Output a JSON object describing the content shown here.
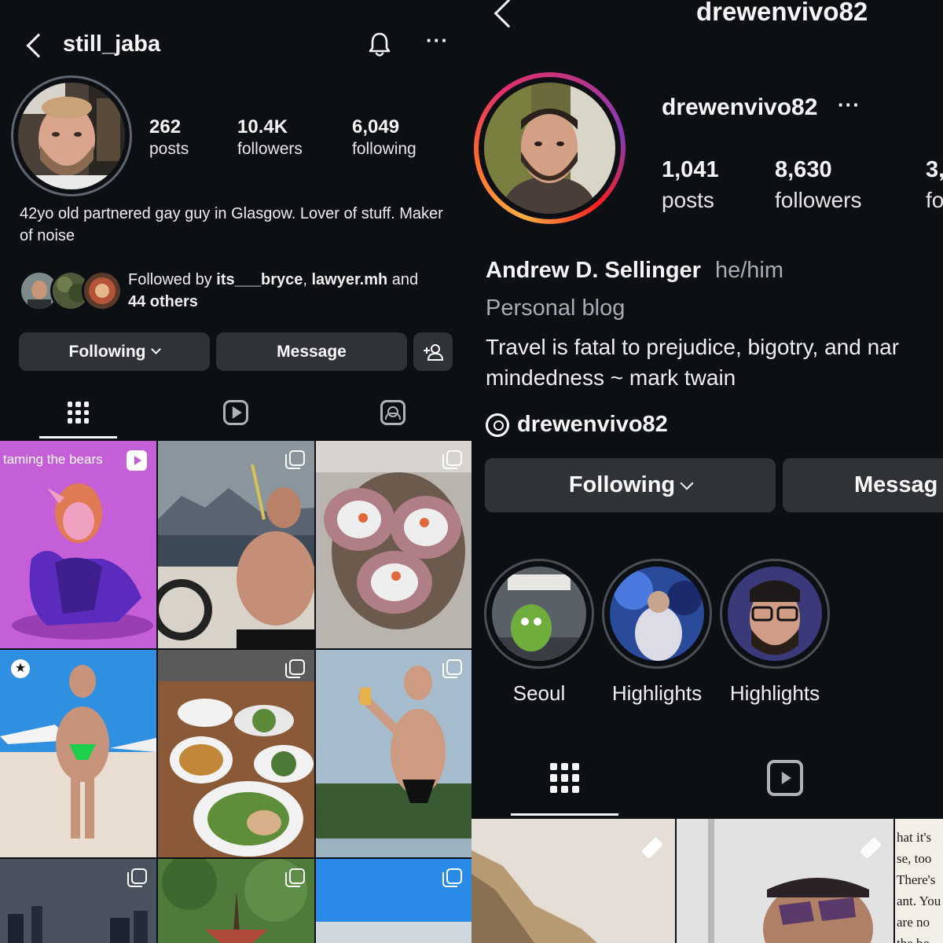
{
  "left": {
    "username": "still_jaba",
    "stats": [
      {
        "value": "262",
        "label": "posts"
      },
      {
        "value": "10.4K",
        "label": "followers"
      },
      {
        "value": "6,049",
        "label": "following"
      }
    ],
    "bio": "42yo old partnered gay guy in Glasgow. Lover of stuff. Maker of noise",
    "followed_by": {
      "prefix": "Followed by ",
      "user1": "its___bryce",
      "sep": ", ",
      "user2": "lawyer.mh",
      "and": " and",
      "others": "44 others"
    },
    "buttons": {
      "following": "Following",
      "message": "Message"
    },
    "reel_tile_caption": "taming the bears",
    "icons": [
      "bell-icon",
      "more-icon",
      "add-person-icon",
      "grid-icon",
      "reels-icon",
      "tagged-icon",
      "multi-post-icon",
      "pinned-star-icon"
    ]
  },
  "right": {
    "username": "drewenvivo82",
    "title": "drewenvivo82",
    "stats": [
      {
        "value": "1,041",
        "label": "posts"
      },
      {
        "value": "8,630",
        "label": "followers"
      },
      {
        "value": "3,",
        "label": "fo"
      }
    ],
    "full_name": "Andrew D. Sellinger",
    "pronouns": "he/him",
    "category": "Personal blog",
    "bio_line1": "Travel is fatal to prejudice, bigotry, and nar",
    "bio_line2": "mindedness ~ mark twain",
    "threads_handle": "drewenvivo82",
    "buttons": {
      "following": "Following",
      "message": "Messag"
    },
    "highlights": [
      "Seoul",
      "Highlights",
      "Highlights"
    ],
    "text_tile_lines": [
      "hat it's",
      "se, too",
      "There's",
      "ant. You",
      "are no",
      "the bo"
    ],
    "icons": [
      "threads-icon",
      "grid-icon",
      "reels-icon",
      "pin-icon"
    ]
  },
  "colors": {
    "background": "#0c0f14",
    "button": "#2f3338",
    "story_ring_gradient": [
      "#fcaf45",
      "#e1306c",
      "#833ab4"
    ]
  }
}
